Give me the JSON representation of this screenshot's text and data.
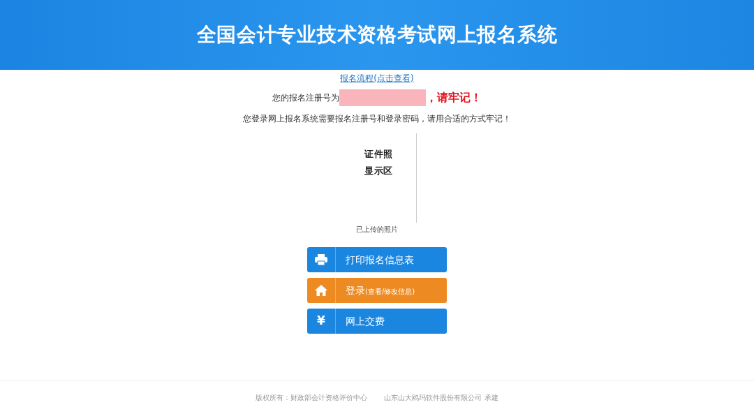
{
  "header": {
    "title": "全国会计专业技术资格考试网上报名系统"
  },
  "process_link": "报名流程(点击查看)",
  "registration": {
    "prefix": "您的报名注册号为",
    "redacted": true,
    "warning": "，请牢记！"
  },
  "notice": "您登录网上报名系统需要报名注册号和登录密码，请用合适的方式牢记！",
  "photo": {
    "placeholder_lines": [
      "证件照",
      "显示区"
    ],
    "caption": "已上传的照片"
  },
  "buttons": [
    {
      "kind": "print",
      "label": "打印报名信息表",
      "color": "#1a86e0"
    },
    {
      "kind": "home",
      "label": "登录",
      "sublabel": "(查看/修改信息)",
      "color": "#ee8a22"
    },
    {
      "kind": "yen",
      "icon_char": "¥",
      "label": "网上交费",
      "color": "#1a86e0"
    }
  ],
  "footer": [
    "版权所有：财政部会计资格评价中心",
    "山东山大鸥玛软件股份有限公司 承建"
  ]
}
